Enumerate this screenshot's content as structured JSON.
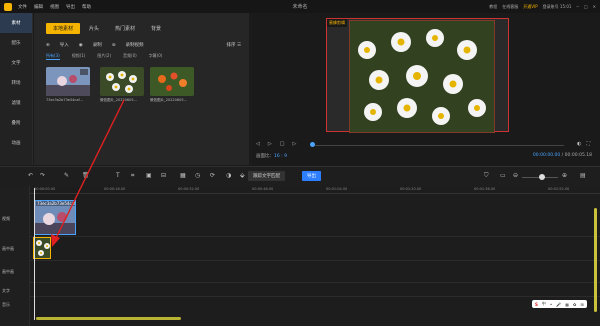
{
  "app": {
    "title": "未命名",
    "menu": [
      "文件",
      "编辑",
      "视图",
      "导出",
      "帮助"
    ],
    "right_links": [
      "教程",
      "在线客服",
      "开通VIP",
      "登录账号 15:01"
    ]
  },
  "nav": {
    "items": [
      "素材",
      "配乐",
      "文字",
      "转场",
      "滤镜",
      "叠附",
      "动画"
    ]
  },
  "library": {
    "tabs": [
      "本地素材",
      "片头",
      "热门素材",
      "背景"
    ],
    "tools": {
      "import": "导入",
      "record": "录制",
      "screen_record": "录制视频"
    },
    "sort": "排序",
    "filters": [
      "所有(3)",
      "视频(1)",
      "图片(2)",
      "音频(0)",
      "字幕(0)"
    ],
    "items": [
      {
        "label": "73ec3a2b73e54caf..."
      },
      {
        "label": "微信图片_20220605..."
      },
      {
        "label": "微信图片_20220605..."
      }
    ]
  },
  "preview": {
    "watermark": "蜜蜂剪辑",
    "ratio_label": "画面比：",
    "ratio_value": "16 : 9",
    "time_current": "00:00:00.00",
    "time_total": "/ 00:00:05.18"
  },
  "toolbar": {
    "icons": [
      "undo-icon",
      "redo-icon",
      "edit-icon",
      "delete-icon",
      "text-icon",
      "crop-icon",
      "freeze-icon",
      "split-icon",
      "mosaic-icon",
      "speed-icon",
      "rotate-icon",
      "color-icon",
      "fill-icon"
    ],
    "match_button": "跟踪文字匹配",
    "export_button": "导出"
  },
  "timeline": {
    "ruler": [
      "00:00:00.00",
      "00:00:16.00",
      "00:00:32.00",
      "00:00:48.00",
      "00:01:04.00",
      "00:01:20.00",
      "00:01:36.00",
      "00:01:52.00"
    ],
    "tracks": [
      "视频",
      "画中画",
      "画中画",
      "文字",
      "音乐"
    ],
    "video_clip_label": "73ec3a2b73e54caf"
  },
  "ime": {
    "label": "中"
  }
}
